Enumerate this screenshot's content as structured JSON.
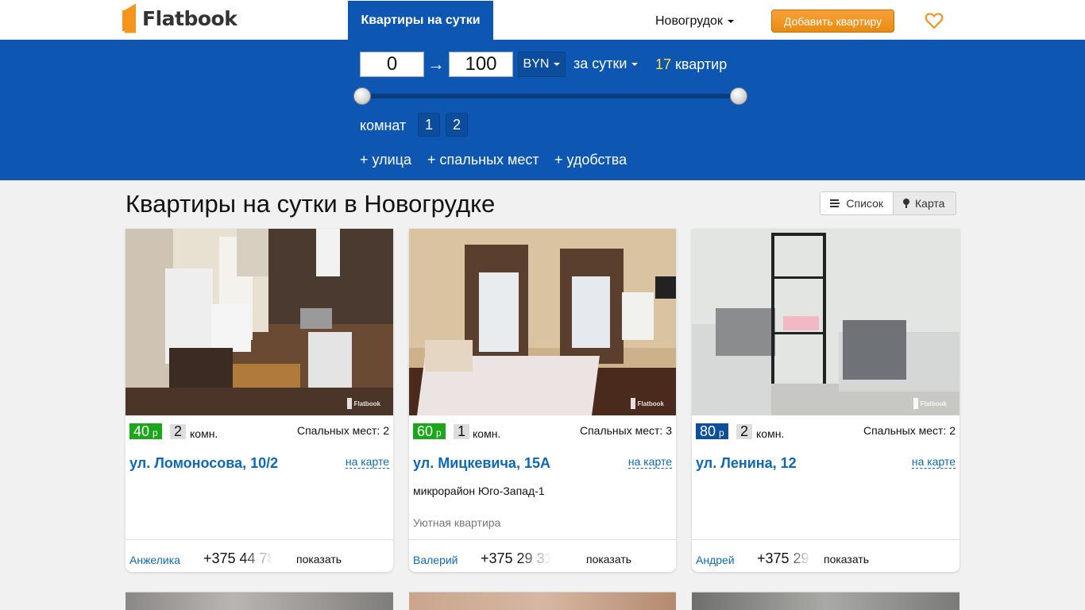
{
  "header": {
    "logo_text": "Flatbook",
    "nav_active": "Квартиры на сутки",
    "city": "Новогрудок",
    "add_button": "Добавить квартиру",
    "brand_color": "#f7941d",
    "accent_color": "#0d57b3"
  },
  "filters": {
    "price_min": "0",
    "price_max": "100",
    "arrow": "→",
    "currency": "BYN",
    "period": "за сутки",
    "result_count": "17",
    "result_label": "квартир",
    "slider_min_fraction": 0,
    "slider_max_fraction": 1,
    "rooms_label": "комнат",
    "rooms_options": [
      "1",
      "2"
    ],
    "extras": [
      "+ улица",
      "+ спальных мест",
      "+ удобства"
    ]
  },
  "main": {
    "title": "Квартиры на сутки в Новогрудке",
    "view_list": "Список",
    "view_map": "Карта"
  },
  "listings": [
    {
      "price": "40",
      "currency_sign": "р",
      "price_color": "#1aa81a",
      "rooms": "2",
      "rooms_unit": "комн.",
      "beds": "Спальных мест: 2",
      "address": "ул. Ломоносова, 10/2",
      "map_link": "на карте",
      "district": "",
      "description": "",
      "owner": "Анжелика",
      "phone_partial": "+375 44 78",
      "show_phone": "показать",
      "watermark": "Flatbook"
    },
    {
      "price": "60",
      "currency_sign": "р",
      "price_color": "#1aa81a",
      "rooms": "1",
      "rooms_unit": "комн.",
      "beds": "Спальных мест: 3",
      "address": "ул. Мицкевича, 15А",
      "map_link": "на карте",
      "district": "микрорайон Юго-Запад-1",
      "description": "Уютная квартира",
      "owner": "Валерий",
      "phone_partial": "+375 29 31",
      "show_phone": "показать",
      "watermark": "Flatbook"
    },
    {
      "price": "80",
      "currency_sign": "р",
      "price_color": "#0d4f9c",
      "rooms": "2",
      "rooms_unit": "комн.",
      "beds": "Спальных мест: 2",
      "address": "ул. Ленина, 12",
      "map_link": "на карте",
      "district": "",
      "description": "",
      "owner": "Андрей",
      "phone_partial": "+375 29",
      "show_phone": "показать",
      "watermark": "Flatbook"
    }
  ]
}
